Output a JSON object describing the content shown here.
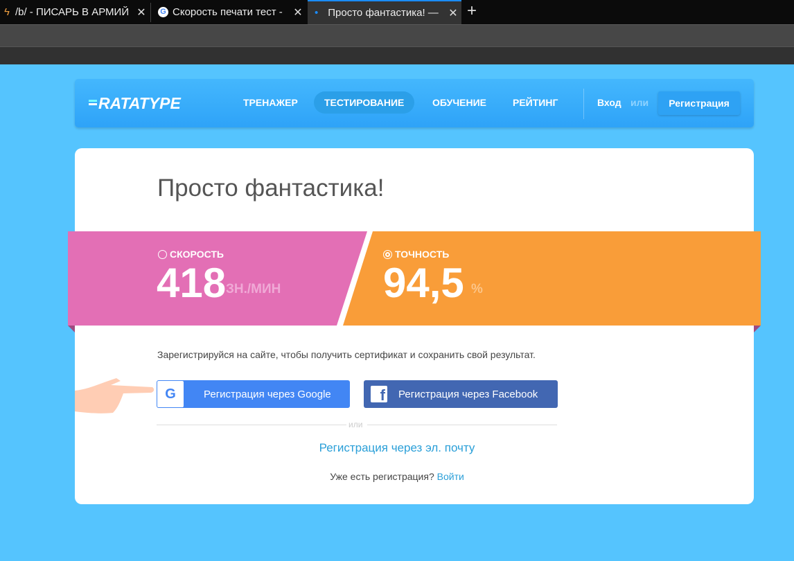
{
  "browser": {
    "tabs": [
      {
        "title": "/b/ - ПИСАРЬ В АРМИЙ",
        "icon": "lightning-icon"
      },
      {
        "title": "Скорость печати тест - ",
        "icon": "google-icon"
      },
      {
        "title": "Просто фантастика! — ",
        "icon": "loading-dot-icon",
        "active": true
      }
    ]
  },
  "header": {
    "logo": "RATATYPE",
    "nav": [
      "ТРЕНАЖЕР",
      "ТЕСТИРОВАНИЕ",
      "ОБУЧЕНИЕ",
      "РЕЙТИНГ"
    ],
    "login": "Вход",
    "or": "или",
    "register": "Регистрация"
  },
  "result": {
    "title": "Просто фантастика!",
    "speed": {
      "label": "СКОРОСТЬ",
      "value": "418",
      "unit": "ЗН./МИН"
    },
    "accuracy": {
      "label": "ТОЧНОСТЬ",
      "value": "94,5",
      "unit": "%"
    }
  },
  "signup": {
    "info": "Зарегистрируйся на сайте, чтобы получить сертификат и сохранить свой результат.",
    "google": "Регистрация через Google",
    "facebook": "Регистрация через Facebook",
    "or": "или",
    "email": "Регистрация через эл. почту",
    "have_account": "Уже есть регистрация?",
    "login": "Войти"
  },
  "colors": {
    "speed": "#e36fb5",
    "accuracy": "#f99d39",
    "page": "#55c4fe"
  }
}
